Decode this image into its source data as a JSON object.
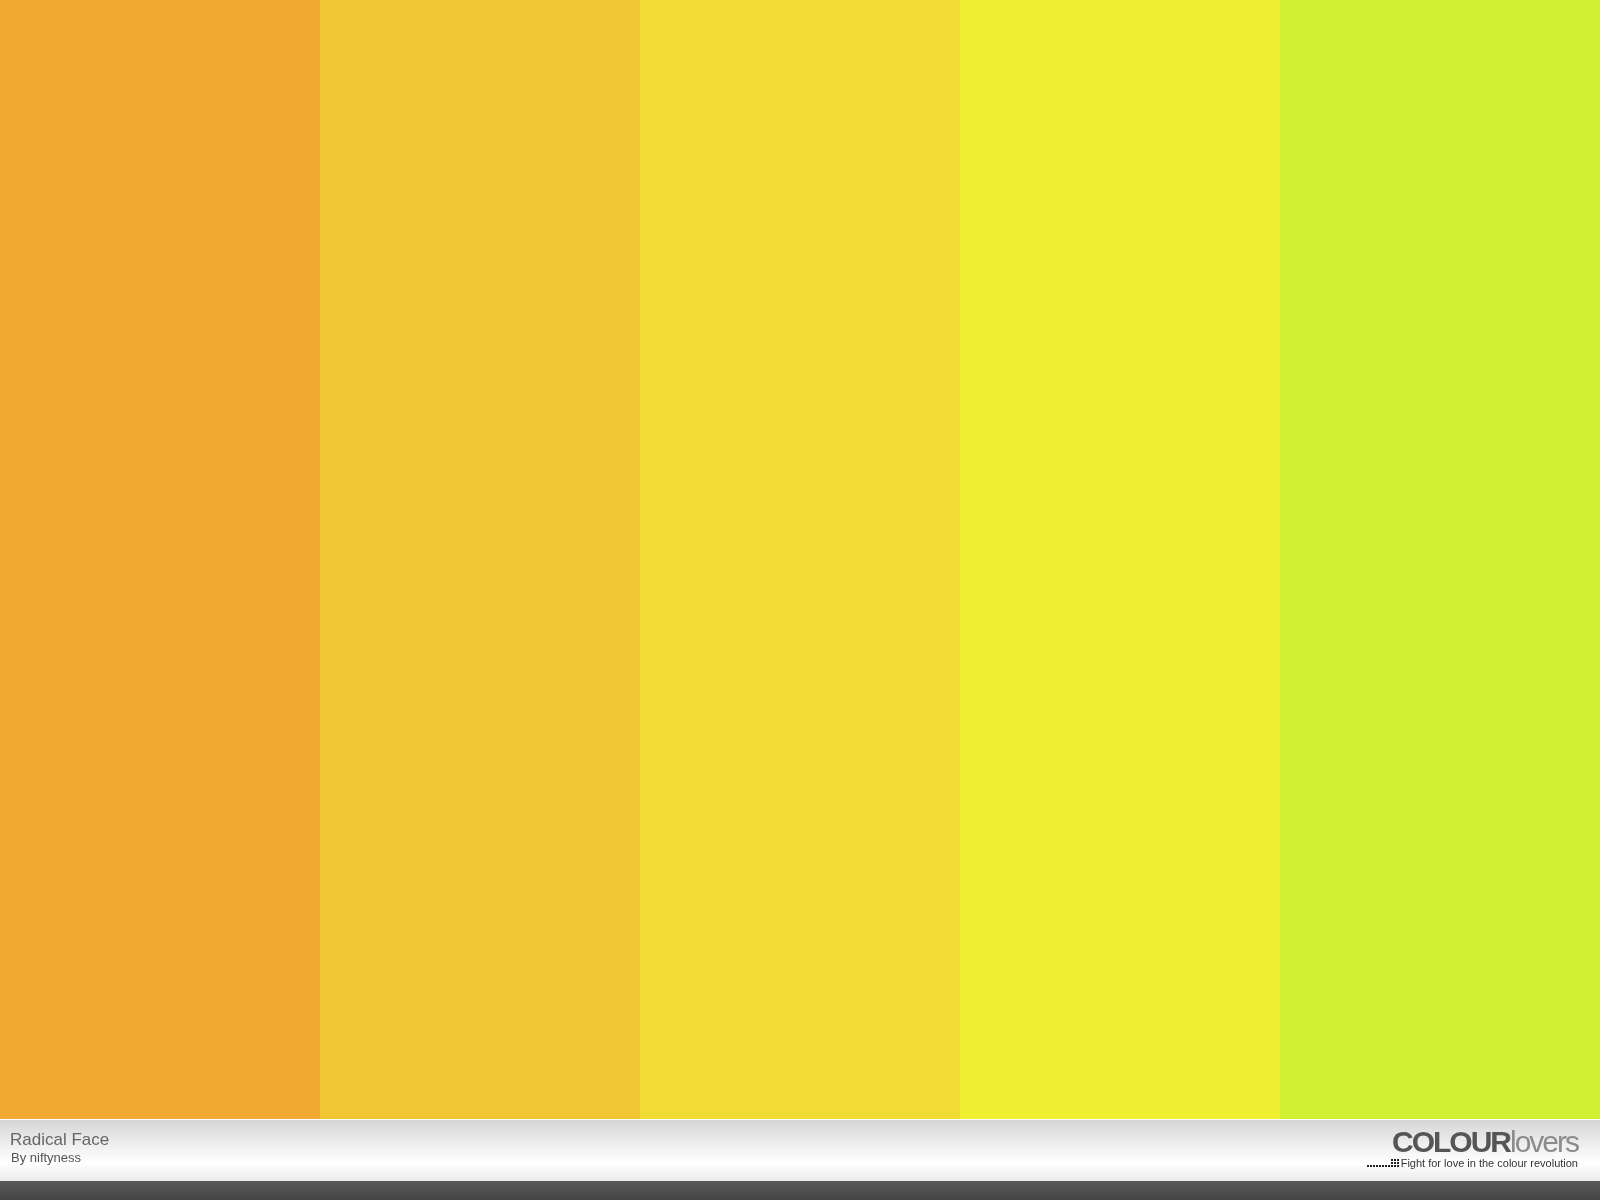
{
  "palette": {
    "swatches": [
      {
        "color": "#f0aa33"
      },
      {
        "color": "#f0c633"
      },
      {
        "color": "#f0dc33"
      },
      {
        "color": "#f0f033"
      },
      {
        "color": "#d2f033"
      }
    ]
  },
  "footer": {
    "title": "Radical Face",
    "author": "By niftyness",
    "logo": "**COLOUR**lovers",
    "tagline": "Fight for love in the colour revolution"
  }
}
